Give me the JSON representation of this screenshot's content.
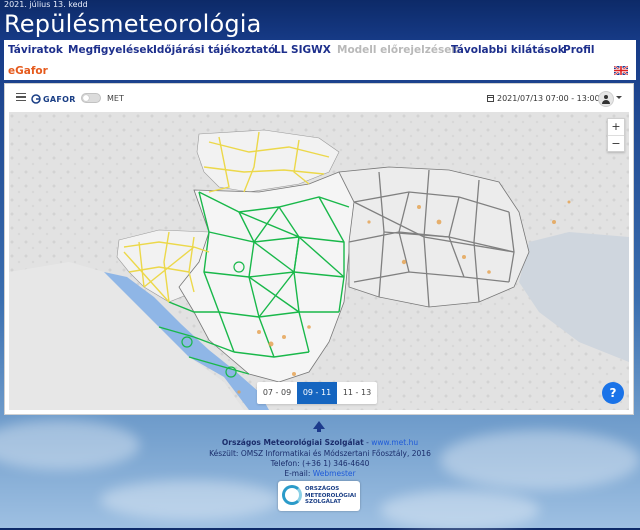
{
  "header": {
    "date": "2021. július 13. kedd",
    "title": "Repülésmeteorológia"
  },
  "nav": {
    "items": [
      {
        "label": "Táviratok"
      },
      {
        "label": "Megfigyelések"
      },
      {
        "label": "Időjárási tájékoztató"
      },
      {
        "label": "LL SIGWX"
      },
      {
        "label": "Modell előrejelzések"
      },
      {
        "label": "Távolabbi kilátások"
      },
      {
        "label": "Profil"
      }
    ],
    "second_row_item": "eGafor",
    "language_flag_icon": "uk-flag-icon"
  },
  "toolbar": {
    "brand": "GAFOR",
    "met_toggle_label": "MET",
    "date_range": "2021/07/13 07:00 - 13:00"
  },
  "map": {
    "zoom_in": "+",
    "zoom_out": "−",
    "time_tabs": [
      "07 - 09",
      "09 - 11",
      "11 - 13"
    ],
    "active_tab": "09 - 11",
    "help": "?",
    "colors": {
      "green": "#19b84a",
      "yellow": "#ecd84a",
      "grey": "#808080",
      "sea": "#8fb6e6"
    }
  },
  "footer": {
    "org": "Országos Meteorológiai Szolgálat",
    "sep": " - ",
    "url": "www.met.hu",
    "made_by": "Készült: OMSZ Informatikai és Módszertani Főosztály, 2016",
    "phone": "Telefon: (+36 1) 346-4640",
    "email_label": "E-mail: ",
    "email_link": "Webmester",
    "logo_line1": "ORSZÁGOS",
    "logo_line2": "METEOROLÓGIAI",
    "logo_line3": "SZOLGÁLAT"
  }
}
